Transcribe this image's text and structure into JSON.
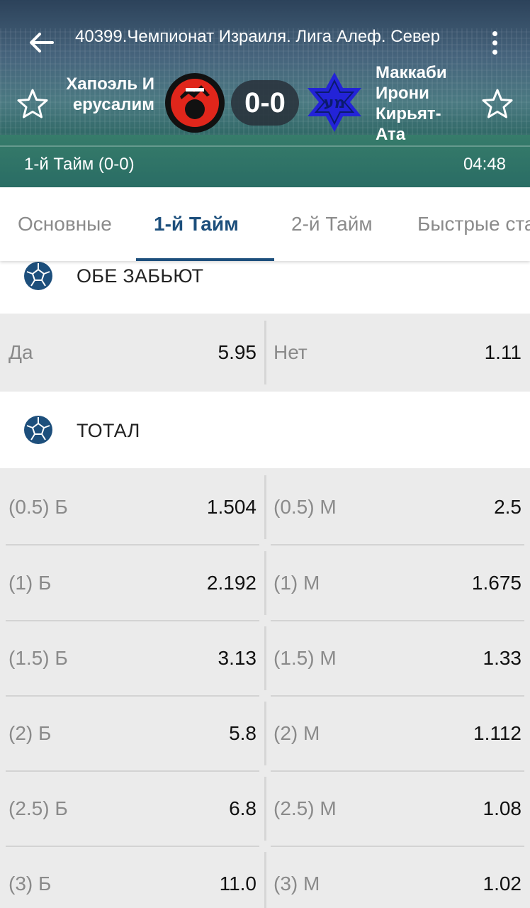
{
  "header": {
    "league_title": "40399.Чемпионат Израиля. Лига Алеф. Север",
    "home_team": "Хапоэль Иерусалим",
    "away_team": "Маккаби Ирони Кирьят-Ата",
    "score": "0-0",
    "period_status": "1-й  Тайм (0-0)",
    "match_time": "04:48"
  },
  "tabs": [
    {
      "label": "Основные",
      "active": false
    },
    {
      "label": "1-й  Тайм",
      "active": true
    },
    {
      "label": "2-й  Тайм",
      "active": false
    },
    {
      "label": "Быстрые ставки",
      "active": false
    }
  ],
  "markets": {
    "both_score": {
      "title": "ОБЕ ЗАБЬЮТ",
      "row": {
        "left_label": "Да",
        "left_odds": "5.95",
        "right_label": "Нет",
        "right_odds": "1.11"
      }
    },
    "total": {
      "title": "ТОТАЛ",
      "rows": [
        {
          "left_label": "(0.5) Б",
          "left_odds": "1.504",
          "right_label": "(0.5) М",
          "right_odds": "2.5"
        },
        {
          "left_label": "(1) Б",
          "left_odds": "2.192",
          "right_label": "(1) М",
          "right_odds": "1.675"
        },
        {
          "left_label": "(1.5) Б",
          "left_odds": "3.13",
          "right_label": "(1.5) М",
          "right_odds": "1.33"
        },
        {
          "left_label": "(2) Б",
          "left_odds": "5.8",
          "right_label": "(2) М",
          "right_odds": "1.112"
        },
        {
          "left_label": "(2.5) Б",
          "left_odds": "6.8",
          "right_label": "(2.5) М",
          "right_odds": "1.08"
        },
        {
          "left_label": "(3) Б",
          "left_odds": "11.0",
          "right_label": "(3) М",
          "right_odds": "1.02"
        }
      ]
    }
  },
  "colors": {
    "accent": "#1d4f7c",
    "home_logo_red": "#e0261b",
    "away_logo_blue": "#2323d8"
  }
}
